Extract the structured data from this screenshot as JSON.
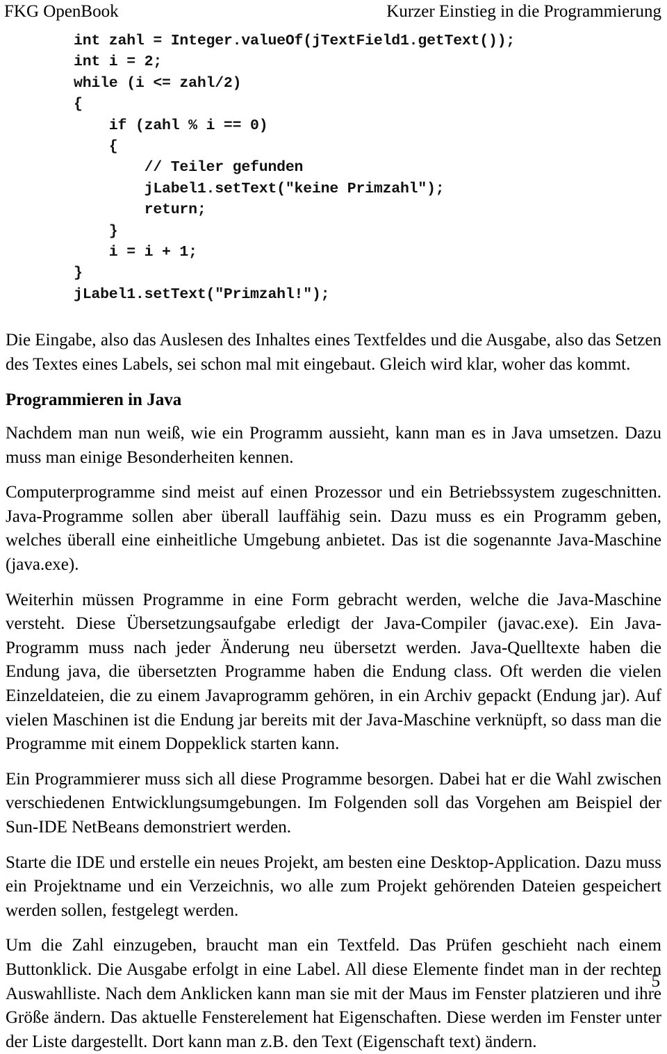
{
  "header": {
    "left": "FKG OpenBook",
    "right": "Kurzer Einstieg in die Programmierung"
  },
  "code_block": {
    "language": "java",
    "lines": [
      "int zahl = Integer.valueOf(jTextField1.getText());",
      "int i = 2;",
      "while (i <= zahl/2)",
      "{",
      "    if (zahl % i == 0)",
      "    {",
      "        // Teiler gefunden",
      "        jLabel1.setText(\"keine Primzahl\");",
      "        return;",
      "    }",
      "    i = i + 1;",
      "}",
      "jLabel1.setText(\"Primzahl!\");"
    ]
  },
  "body": {
    "paragraph_1": "Die Eingabe, also das Auslesen des Inhaltes eines Textfeldes und die Ausgabe, also das Setzen des Textes eines Labels, sei schon mal mit eingebaut. Gleich wird klar, woher das kommt.",
    "heading_1": "Programmieren in Java",
    "paragraph_2": "Nachdem man nun weiß, wie ein Programm aussieht, kann man es in Java umsetzen. Dazu muss man einige Besonderheiten kennen.",
    "paragraph_3": "Computerprogramme sind meist auf einen Prozessor und ein Betriebssystem zugeschnitten. Java-Programme sollen aber überall lauffähig sein. Dazu muss es ein Programm geben, welches überall eine einheitliche Umgebung anbietet. Das ist die sogenannte Java-Maschine (java.exe).",
    "paragraph_4": "Weiterhin müssen Programme in eine Form gebracht werden, welche die Java-Maschine versteht. Diese Übersetzungsaufgabe erledigt der Java-Compiler (javac.exe). Ein Java-Programm muss nach jeder Änderung neu übersetzt werden. Java-Quelltexte haben die Endung java, die übersetzten Programme haben die Endung class. Oft werden die vielen Einzeldateien, die zu einem Javaprogramm gehören, in ein Archiv gepackt (Endung jar). Auf vielen Maschinen ist die Endung jar bereits mit der Java-Maschine verknüpft, so dass man die Programme mit einem Doppeklick starten kann.",
    "paragraph_5": "Ein Programmierer muss sich all diese Programme besorgen. Dabei hat er die Wahl zwischen verschiedenen Entwicklungsumgebungen. Im Folgenden soll das Vorgehen am Beispiel der Sun-IDE NetBeans demonstriert werden.",
    "paragraph_6": "Starte die IDE und erstelle ein neues Projekt, am besten eine Desktop-Application. Dazu muss ein Projektname und ein Verzeichnis, wo alle zum Projekt gehörenden Dateien gespeichert werden sollen, festgelegt werden.",
    "paragraph_7": "Um die Zahl einzugeben, braucht man ein Textfeld.  Das Prüfen geschieht nach einem Buttonklick. Die Ausgabe erfolgt in eine Label. All diese Elemente findet man in der rechten Auswahlliste. Nach dem Anklicken kann man sie mit der Maus im Fenster platzieren und ihre Größe ändern. Das aktuelle Fensterelement hat Eigenschaften. Diese werden im Fenster unter der Liste dargestellt. Dort kann man z.B. den Text (Eigenschaft text) ändern."
  },
  "footer": {
    "page_number": "5"
  }
}
